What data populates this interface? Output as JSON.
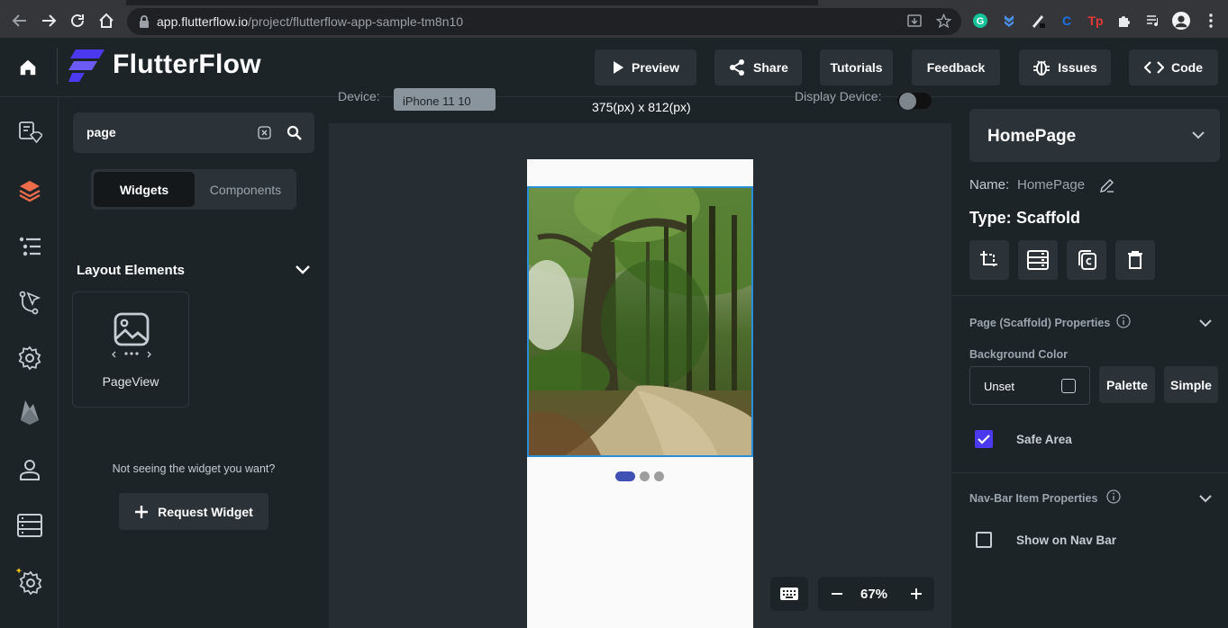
{
  "browser": {
    "url_host": "app.flutterflow.io",
    "url_path": "/project/flutterflow-app-sample-tm8n10",
    "extensions": [
      "grammarly-icon",
      "bookmark-ext-icon",
      "pen-ext-icon",
      "c-ext-icon",
      "tp-ext-icon",
      "puzzle-icon",
      "playlist-icon",
      "profile-avatar",
      "kebab-menu-icon"
    ],
    "ext_tp_label": "Tp",
    "ext_c_label": "C"
  },
  "header": {
    "brand": "FlutterFlow",
    "buttons": {
      "preview": "Preview",
      "share": "Share",
      "tutorials": "Tutorials",
      "feedback": "Feedback",
      "issues": "Issues",
      "code": "Code"
    }
  },
  "rail": {
    "icons": [
      "theme-diamond-icon",
      "layers-icon",
      "tree-list-icon",
      "connections-icon",
      "settings-gear-icon",
      "firebase-icon",
      "user-icon",
      "database-icon",
      "magic-gear-icon"
    ]
  },
  "widgets_panel": {
    "search_value": "page",
    "tabs": {
      "widgets": "Widgets",
      "components": "Components"
    },
    "section_title": "Layout Elements",
    "items": [
      {
        "label": "PageView",
        "icon": "pageview-icon"
      }
    ],
    "missing_text": "Not seeing the widget you want?",
    "request_button": "Request Widget"
  },
  "canvas": {
    "device_label": "Device:",
    "device_value": "iPhone 11 10",
    "dimensions": "375(px) x 812(px)",
    "display_device_label": "Display Device:",
    "zoom": "67%",
    "pageview_indicator": {
      "count": 3,
      "active": 0
    },
    "colors": {
      "accent": "#4b39ef",
      "indicator_active": "#3f51b5",
      "indicator_dot": "#9e9e9e",
      "selection": "#2b8fd8"
    }
  },
  "properties": {
    "page_select": "HomePage",
    "name_label": "Name:",
    "name_value": "HomePage",
    "type_label": "Type:",
    "type_value": "Scaffold",
    "scaffold_section": "Page (Scaffold) Properties",
    "bg_color_label": "Background Color",
    "bg_color_value": "Unset",
    "palette_btn": "Palette",
    "simple_btn": "Simple",
    "safe_area_label": "Safe Area",
    "safe_area_checked": true,
    "navbar_section": "Nav-Bar Item Properties",
    "show_navbar_label": "Show on Nav Bar",
    "show_navbar_checked": false
  }
}
